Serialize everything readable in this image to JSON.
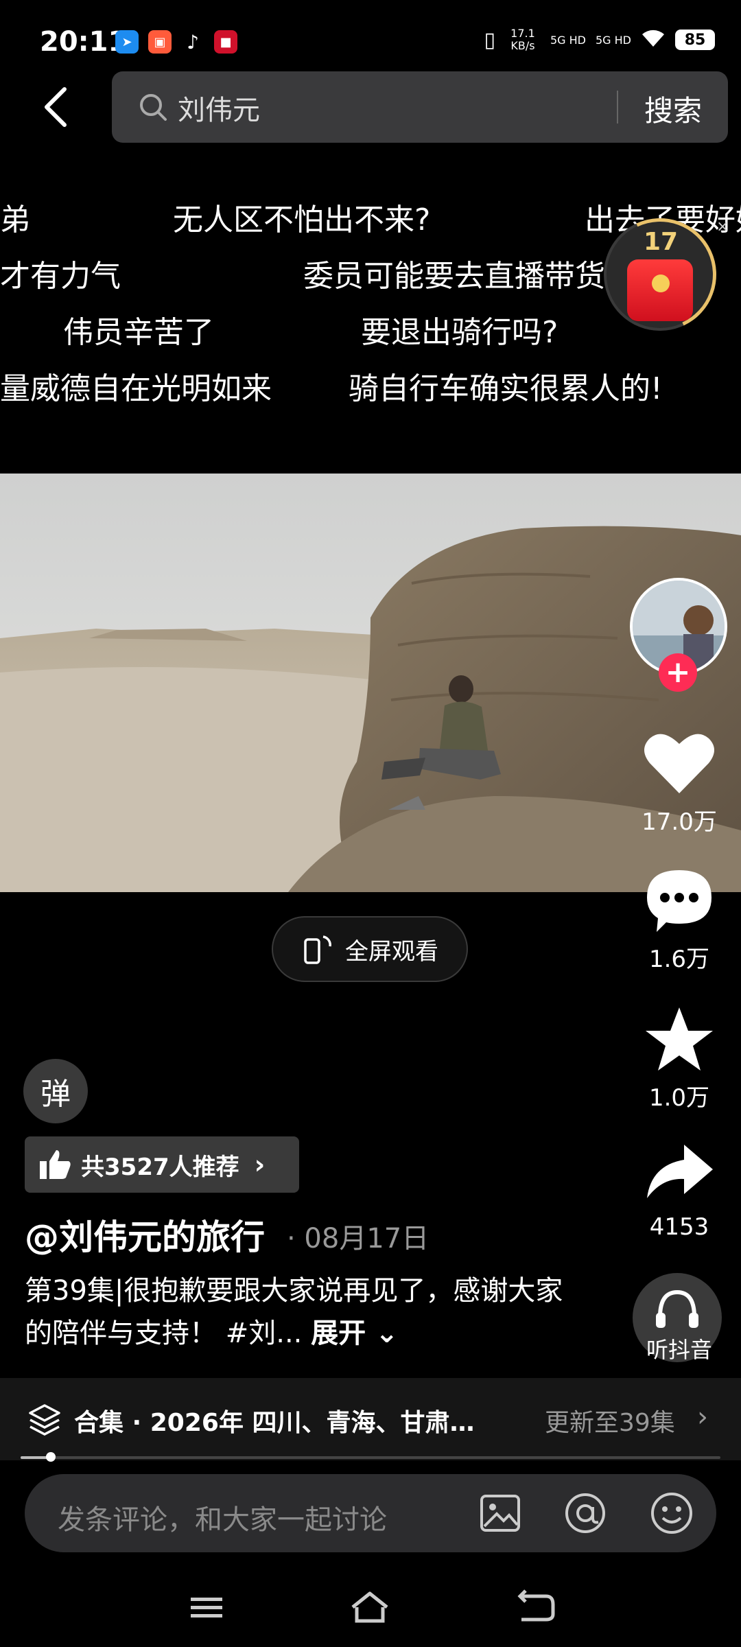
{
  "status_bar": {
    "time": "20:11",
    "network_speed": "17.1 KB/s",
    "signal_1": "5G HD",
    "signal_2": "5G HD",
    "battery": "85"
  },
  "search": {
    "query": "刘伟元",
    "button_label": "搜索"
  },
  "danmaku": [
    {
      "text": "弟"
    },
    {
      "text": "无人区不怕出不来?"
    },
    {
      "text": "出去了要好好"
    },
    {
      "text": "才有力气"
    },
    {
      "text": "委员可能要去直播带货了"
    },
    {
      "text": "伟员辛苦了"
    },
    {
      "text": "要退出骑行吗?"
    },
    {
      "text": "量威德自在光明如来"
    },
    {
      "text": "骑自行车确实很累人的!"
    }
  ],
  "red_packet": {
    "count": "17",
    "close": "×"
  },
  "fullscreen": {
    "label": "全屏观看"
  },
  "actions": {
    "like_count": "17.0万",
    "comment_count": "1.6万",
    "favorite_count": "1.0万",
    "share_count": "4153",
    "listen_label": "听抖音",
    "follow_plus": "+"
  },
  "danmaku_toggle": {
    "label": "弹"
  },
  "recommend": {
    "text": "共3527人推荐"
  },
  "post": {
    "author": "@刘伟元的旅行",
    "date": "· 08月17日",
    "description": "第39集|很抱歉要跟大家说再见了，感谢大家的陪伴与支持！ #刘...",
    "expand_label": "展开"
  },
  "collection": {
    "text": "合集 · 2026年 四川、青海、甘肃…",
    "update": "更新至39集"
  },
  "progress": {
    "fraction": 0.043
  },
  "comment": {
    "placeholder": "发条评论，和大家一起讨论"
  },
  "colors": {
    "accent": "#fe2c55",
    "background": "#000000"
  }
}
